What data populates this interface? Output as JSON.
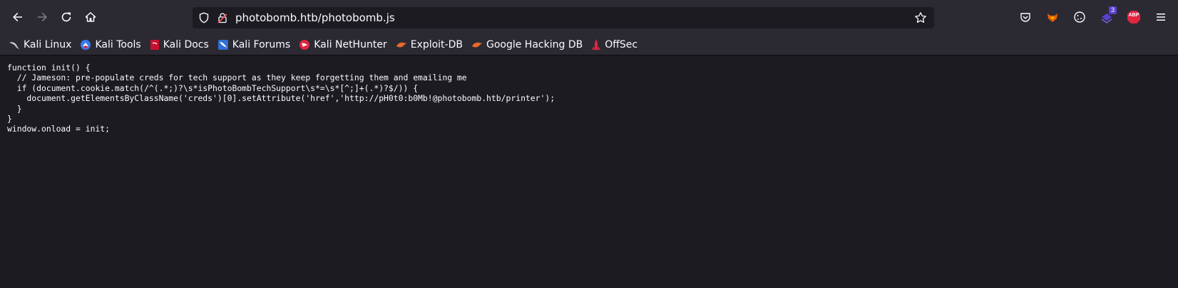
{
  "toolbar": {
    "back_icon": "arrow-left-icon",
    "forward_icon": "arrow-right-icon",
    "reload_icon": "reload-icon",
    "home_icon": "home-icon"
  },
  "urlbar": {
    "url": "photobomb.htb/photobomb.js",
    "shield_icon": "shield-icon",
    "insecure_lock_icon": "lock-slash-icon",
    "star_icon": "star-icon"
  },
  "extensions": {
    "pocket_icon": "pocket-icon",
    "foxy_icon": "fox-icon",
    "cookie_icon": "cookie-icon",
    "badge_count": "3",
    "abp_label": "ABP",
    "menu_icon": "hamburger-menu-icon"
  },
  "bookmarks": [
    {
      "label": "Kali Linux",
      "icon": "kali-dragon-icon"
    },
    {
      "label": "Kali Tools",
      "icon": "kali-tools-icon"
    },
    {
      "label": "Kali Docs",
      "icon": "kali-docs-icon"
    },
    {
      "label": "Kali Forums",
      "icon": "kali-forums-icon"
    },
    {
      "label": "Kali NetHunter",
      "icon": "nethunter-icon"
    },
    {
      "label": "Exploit-DB",
      "icon": "exploit-db-icon"
    },
    {
      "label": "Google Hacking DB",
      "icon": "ghdb-icon"
    },
    {
      "label": "OffSec",
      "icon": "offsec-icon"
    }
  ],
  "colors": {
    "toolbar_bg": "#2b2a33",
    "page_bg": "#1c1b22",
    "text": "#fbfbfe"
  },
  "content": {
    "lines": [
      "function init() {",
      "  // Jameson: pre-populate creds for tech support as they keep forgetting them and emailing me",
      "  if (document.cookie.match(/^(.*;)?\\s*isPhotoBombTechSupport\\s*=\\s*[^;]+(.*)?$/)) {",
      "    document.getElementsByClassName('creds')[0].setAttribute('href','http://pH0t0:b0Mb!@photobomb.htb/printer');",
      "  }",
      "}",
      "window.onload = init;"
    ]
  }
}
